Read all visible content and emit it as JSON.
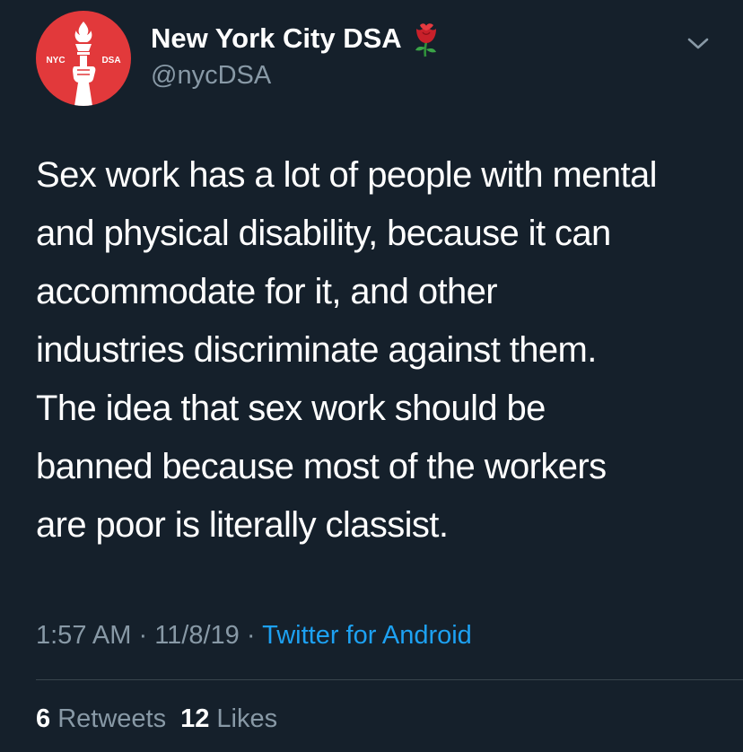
{
  "author": {
    "display_name": "New York City DSA",
    "handle": "@nycDSA",
    "name_emoji_icon": "rose-icon",
    "avatar": {
      "left_text": "NYC",
      "right_text": "DSA",
      "background": "#e2393b",
      "icon": "torch-fist-icon"
    }
  },
  "menu_icon": "chevron-down-icon",
  "tweet": {
    "lines": [
      "Sex work has a lot of people with mental",
      "and physical disability, because it can",
      "accommodate for it, and other",
      "industries discriminate against them.",
      "The idea that sex work should be",
      "banned because most of the workers",
      "are poor is literally classist."
    ]
  },
  "meta": {
    "time": "1:57 AM",
    "date": "11/8/19",
    "separator": "·",
    "source": "Twitter for Android"
  },
  "stats": {
    "retweets_count": "6",
    "retweets_label": "Retweets",
    "likes_count": "12",
    "likes_label": "Likes"
  },
  "colors": {
    "background": "#15202b",
    "text_primary": "#ffffff",
    "text_secondary": "#8899a6",
    "link": "#1da1f2",
    "divider": "#38444d"
  }
}
